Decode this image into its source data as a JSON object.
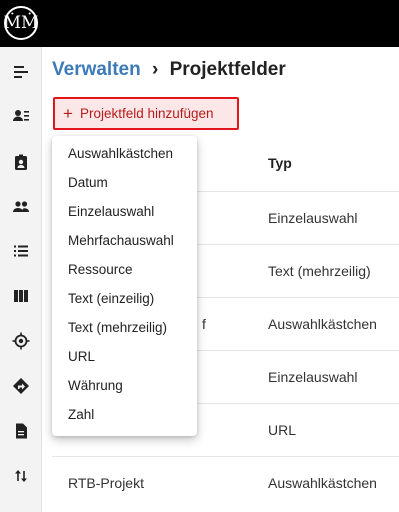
{
  "app": {
    "logo_text": "ṀṀ"
  },
  "sidebar": {
    "items": [
      {
        "icon": "menu-collapse-icon"
      },
      {
        "icon": "contacts-list-icon"
      },
      {
        "icon": "clipboard-account-icon"
      },
      {
        "icon": "people-icon"
      },
      {
        "icon": "list-icon"
      },
      {
        "icon": "columns-icon"
      },
      {
        "icon": "crosshair-icon"
      },
      {
        "icon": "direction-sign-icon"
      },
      {
        "icon": "document-icon"
      },
      {
        "icon": "swap-vertical-icon"
      }
    ]
  },
  "breadcrumb": {
    "parent": "Verwalten",
    "separator": "›",
    "current": "Projektfelder"
  },
  "toolbar": {
    "add_label": "Projektfeld hinzufügen"
  },
  "table": {
    "type_header": "Typ",
    "rows": [
      {
        "name": "",
        "type": "Einzelauswahl"
      },
      {
        "name": "",
        "type": "Text (mehrzeilig)"
      },
      {
        "name": "f",
        "type": "Auswahlkästchen"
      },
      {
        "name": "",
        "type": "Einzelauswahl"
      },
      {
        "name": "",
        "type": "URL"
      },
      {
        "name": "RTB-Projekt",
        "type": "Auswahlkästchen"
      }
    ]
  },
  "dropdown": {
    "items": [
      "Auswahlkästchen",
      "Datum",
      "Einzelauswahl",
      "Mehrfachauswahl",
      "Ressource",
      "Text (einzeilig)",
      "Text (mehrzeilig)",
      "URL",
      "Währung",
      "Zahl"
    ]
  },
  "colors": {
    "accent": "#e0161c",
    "link": "#3d7ab8",
    "topbar": "#000000"
  }
}
